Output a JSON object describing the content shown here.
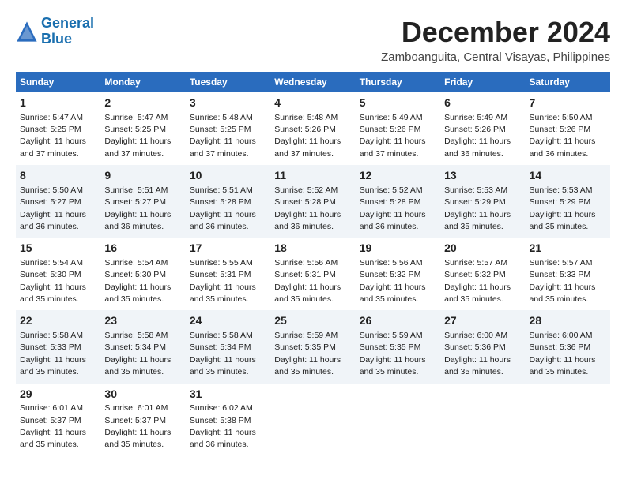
{
  "logo": {
    "line1": "General",
    "line2": "Blue"
  },
  "title": "December 2024",
  "subtitle": "Zamboanguita, Central Visayas, Philippines",
  "headers": [
    "Sunday",
    "Monday",
    "Tuesday",
    "Wednesday",
    "Thursday",
    "Friday",
    "Saturday"
  ],
  "weeks": [
    [
      {
        "day": "1",
        "sunrise": "Sunrise: 5:47 AM",
        "sunset": "Sunset: 5:25 PM",
        "daylight": "Daylight: 11 hours and 37 minutes."
      },
      {
        "day": "2",
        "sunrise": "Sunrise: 5:47 AM",
        "sunset": "Sunset: 5:25 PM",
        "daylight": "Daylight: 11 hours and 37 minutes."
      },
      {
        "day": "3",
        "sunrise": "Sunrise: 5:48 AM",
        "sunset": "Sunset: 5:25 PM",
        "daylight": "Daylight: 11 hours and 37 minutes."
      },
      {
        "day": "4",
        "sunrise": "Sunrise: 5:48 AM",
        "sunset": "Sunset: 5:26 PM",
        "daylight": "Daylight: 11 hours and 37 minutes."
      },
      {
        "day": "5",
        "sunrise": "Sunrise: 5:49 AM",
        "sunset": "Sunset: 5:26 PM",
        "daylight": "Daylight: 11 hours and 37 minutes."
      },
      {
        "day": "6",
        "sunrise": "Sunrise: 5:49 AM",
        "sunset": "Sunset: 5:26 PM",
        "daylight": "Daylight: 11 hours and 36 minutes."
      },
      {
        "day": "7",
        "sunrise": "Sunrise: 5:50 AM",
        "sunset": "Sunset: 5:26 PM",
        "daylight": "Daylight: 11 hours and 36 minutes."
      }
    ],
    [
      {
        "day": "8",
        "sunrise": "Sunrise: 5:50 AM",
        "sunset": "Sunset: 5:27 PM",
        "daylight": "Daylight: 11 hours and 36 minutes."
      },
      {
        "day": "9",
        "sunrise": "Sunrise: 5:51 AM",
        "sunset": "Sunset: 5:27 PM",
        "daylight": "Daylight: 11 hours and 36 minutes."
      },
      {
        "day": "10",
        "sunrise": "Sunrise: 5:51 AM",
        "sunset": "Sunset: 5:28 PM",
        "daylight": "Daylight: 11 hours and 36 minutes."
      },
      {
        "day": "11",
        "sunrise": "Sunrise: 5:52 AM",
        "sunset": "Sunset: 5:28 PM",
        "daylight": "Daylight: 11 hours and 36 minutes."
      },
      {
        "day": "12",
        "sunrise": "Sunrise: 5:52 AM",
        "sunset": "Sunset: 5:28 PM",
        "daylight": "Daylight: 11 hours and 36 minutes."
      },
      {
        "day": "13",
        "sunrise": "Sunrise: 5:53 AM",
        "sunset": "Sunset: 5:29 PM",
        "daylight": "Daylight: 11 hours and 35 minutes."
      },
      {
        "day": "14",
        "sunrise": "Sunrise: 5:53 AM",
        "sunset": "Sunset: 5:29 PM",
        "daylight": "Daylight: 11 hours and 35 minutes."
      }
    ],
    [
      {
        "day": "15",
        "sunrise": "Sunrise: 5:54 AM",
        "sunset": "Sunset: 5:30 PM",
        "daylight": "Daylight: 11 hours and 35 minutes."
      },
      {
        "day": "16",
        "sunrise": "Sunrise: 5:54 AM",
        "sunset": "Sunset: 5:30 PM",
        "daylight": "Daylight: 11 hours and 35 minutes."
      },
      {
        "day": "17",
        "sunrise": "Sunrise: 5:55 AM",
        "sunset": "Sunset: 5:31 PM",
        "daylight": "Daylight: 11 hours and 35 minutes."
      },
      {
        "day": "18",
        "sunrise": "Sunrise: 5:56 AM",
        "sunset": "Sunset: 5:31 PM",
        "daylight": "Daylight: 11 hours and 35 minutes."
      },
      {
        "day": "19",
        "sunrise": "Sunrise: 5:56 AM",
        "sunset": "Sunset: 5:32 PM",
        "daylight": "Daylight: 11 hours and 35 minutes."
      },
      {
        "day": "20",
        "sunrise": "Sunrise: 5:57 AM",
        "sunset": "Sunset: 5:32 PM",
        "daylight": "Daylight: 11 hours and 35 minutes."
      },
      {
        "day": "21",
        "sunrise": "Sunrise: 5:57 AM",
        "sunset": "Sunset: 5:33 PM",
        "daylight": "Daylight: 11 hours and 35 minutes."
      }
    ],
    [
      {
        "day": "22",
        "sunrise": "Sunrise: 5:58 AM",
        "sunset": "Sunset: 5:33 PM",
        "daylight": "Daylight: 11 hours and 35 minutes."
      },
      {
        "day": "23",
        "sunrise": "Sunrise: 5:58 AM",
        "sunset": "Sunset: 5:34 PM",
        "daylight": "Daylight: 11 hours and 35 minutes."
      },
      {
        "day": "24",
        "sunrise": "Sunrise: 5:58 AM",
        "sunset": "Sunset: 5:34 PM",
        "daylight": "Daylight: 11 hours and 35 minutes."
      },
      {
        "day": "25",
        "sunrise": "Sunrise: 5:59 AM",
        "sunset": "Sunset: 5:35 PM",
        "daylight": "Daylight: 11 hours and 35 minutes."
      },
      {
        "day": "26",
        "sunrise": "Sunrise: 5:59 AM",
        "sunset": "Sunset: 5:35 PM",
        "daylight": "Daylight: 11 hours and 35 minutes."
      },
      {
        "day": "27",
        "sunrise": "Sunrise: 6:00 AM",
        "sunset": "Sunset: 5:36 PM",
        "daylight": "Daylight: 11 hours and 35 minutes."
      },
      {
        "day": "28",
        "sunrise": "Sunrise: 6:00 AM",
        "sunset": "Sunset: 5:36 PM",
        "daylight": "Daylight: 11 hours and 35 minutes."
      }
    ],
    [
      {
        "day": "29",
        "sunrise": "Sunrise: 6:01 AM",
        "sunset": "Sunset: 5:37 PM",
        "daylight": "Daylight: 11 hours and 35 minutes."
      },
      {
        "day": "30",
        "sunrise": "Sunrise: 6:01 AM",
        "sunset": "Sunset: 5:37 PM",
        "daylight": "Daylight: 11 hours and 35 minutes."
      },
      {
        "day": "31",
        "sunrise": "Sunrise: 6:02 AM",
        "sunset": "Sunset: 5:38 PM",
        "daylight": "Daylight: 11 hours and 36 minutes."
      },
      null,
      null,
      null,
      null
    ]
  ]
}
